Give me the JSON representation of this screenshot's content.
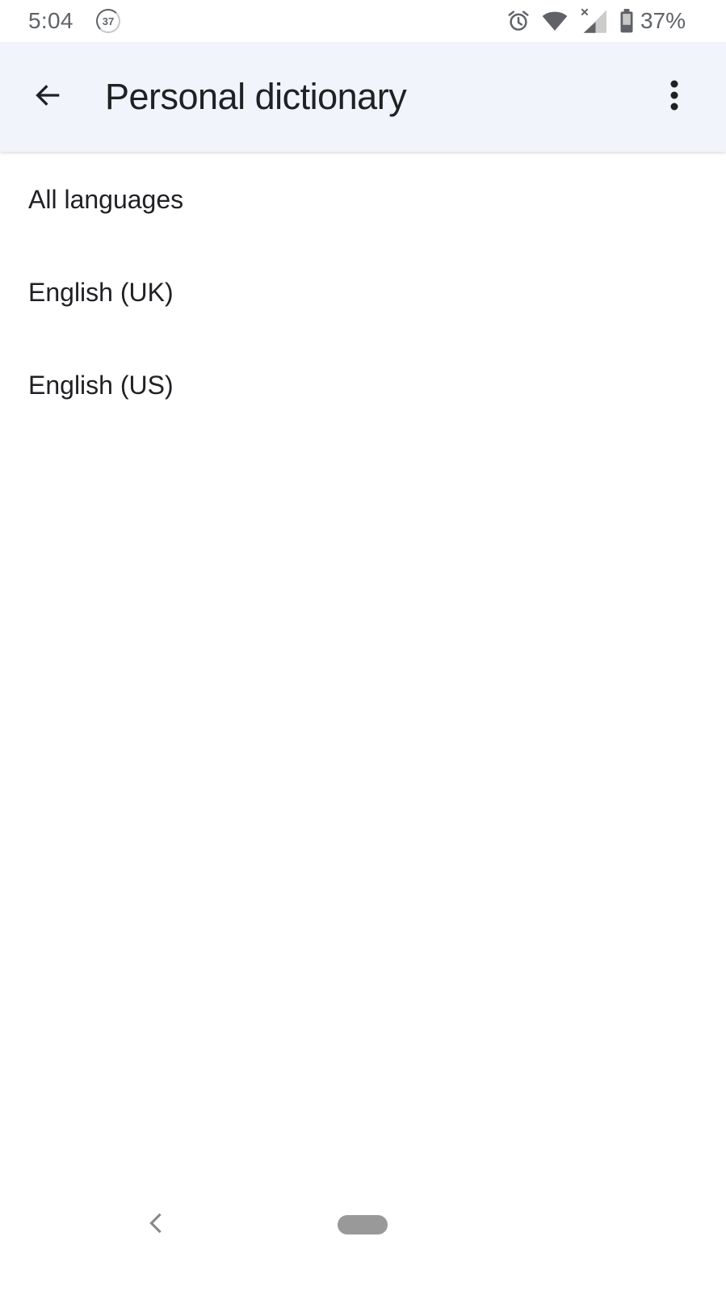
{
  "status_bar": {
    "time": "5:04",
    "notification_badge": "37",
    "icons": [
      "alarm-icon",
      "wifi-icon",
      "signal-no-data-icon",
      "battery-icon"
    ],
    "battery_percent": "37%"
  },
  "app_bar": {
    "back_icon": "arrow-back-icon",
    "title": "Personal dictionary",
    "more_icon": "more-vert-icon"
  },
  "languages": [
    {
      "label": "All languages"
    },
    {
      "label": "English (UK)"
    },
    {
      "label": "English (US)"
    }
  ],
  "nav_bar": {
    "back_icon": "chevron-left-icon",
    "home_icon": "home-pill-icon"
  },
  "colors": {
    "app_bar_bg": "#f1f4fb",
    "text_primary": "#202124",
    "status_gray": "#5f6368"
  }
}
